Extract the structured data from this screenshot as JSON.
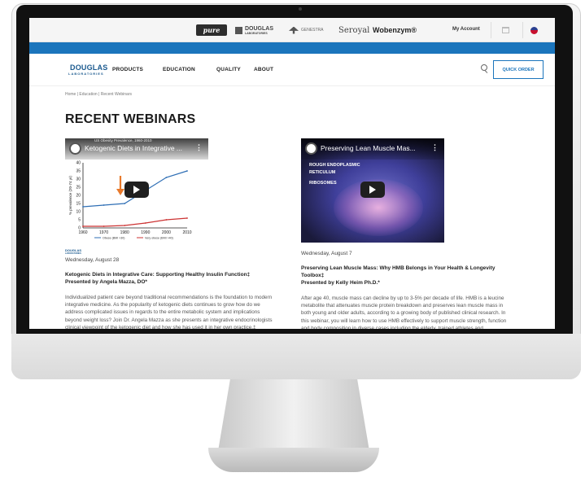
{
  "brands": {
    "pure": "pure",
    "douglas_top": "DOUGLAS",
    "douglas_bottom": "LABORATORIES",
    "genestra": "GENESTRA",
    "seroyal": "Seroyal",
    "wobenzym": "Wobenzym®"
  },
  "account": {
    "my_account": "My Account",
    "cart_icon": "cart-icon",
    "flag_icon": "us-flag-icon"
  },
  "accent_color": "#1b75bc",
  "logo": {
    "name": "DOUGLAS",
    "sub": "LABORATORIES"
  },
  "nav": {
    "products": "PRODUCTS",
    "education": "EDUCATION",
    "quality": "QUALITY",
    "about": "ABOUT",
    "search_icon": "search-icon",
    "quick_order": "QUICK ORDER"
  },
  "breadcrumb": "Home | Education | Recent Webinars",
  "page_title": "RECENT WEBINARS",
  "webinars": [
    {
      "video_title": "Ketogenic Diets in Integrative ...",
      "chart_heading": "US Obesity Prevalence, 1960-2010",
      "thumb_brand_top": "DOUGLAS",
      "thumb_brand_bottom": "LABORATORIES",
      "date": "Wednesday, August 28",
      "title": "Ketogenic Diets in Integrative Care: Supporting Healthy Insulin Function‡",
      "presenter": "Presented by Angela Mazza, DO*",
      "description": "Individualized patient care beyond traditional recommendations is the foundation to modern integrative medicine. As the popularity of ketogenic diets continues to grow how do we address complicated issues in regards to the entire metabolic system and implications beyond weight loss? Join Dr. Angela Mazza as she presents an integrative endocrinologists clinical viewpoint of the ketogenic diet and how she has used it in her own practice.‡",
      "chart_data": {
        "type": "line",
        "title": "US Obesity Prevalence, 1960-2010",
        "ylabel": "% prevalence (20-74 yr)",
        "x": [
          1960,
          1970,
          1980,
          1990,
          2000,
          2010
        ],
        "ylim": [
          0,
          40
        ],
        "yticks": [
          0,
          5,
          10,
          15,
          20,
          25,
          30,
          35,
          40
        ],
        "series": [
          {
            "name": "Obese (BMI >30)",
            "color": "#2f6fb5",
            "values": [
              13,
              14,
              15,
              23,
              31,
              35
            ]
          },
          {
            "name": "Very obese (BMI >40)",
            "color": "#cc3333",
            "values": [
              1,
              1,
              1.5,
              3,
              5,
              6
            ]
          }
        ]
      }
    },
    {
      "video_title": "Preserving Lean Muscle Mas...",
      "cell_labels": [
        "ROUGH ENDOPLASMIC",
        "RETICULUM",
        "RIBOSOMES"
      ],
      "date": "Wednesday, August 7",
      "title": "Preserving Lean Muscle Mass: Why HMB Belongs in Your Health & Longevity Toolbox‡",
      "presenter": "Presented by Kelly Heim Ph.D.*",
      "description": "After age 40, muscle mass can decline by up to 3-5% per decade of life. HMB is a leucine metabolite that attenuates muscle protein breakdown and preserves lean muscle mass in both young and older adults, according to a growing body of published clinical research. In this webinar, you will learn how to use HMB effectively to support muscle strength, function and body composition in diverse cases including the elderly, trained athletes and"
    }
  ]
}
